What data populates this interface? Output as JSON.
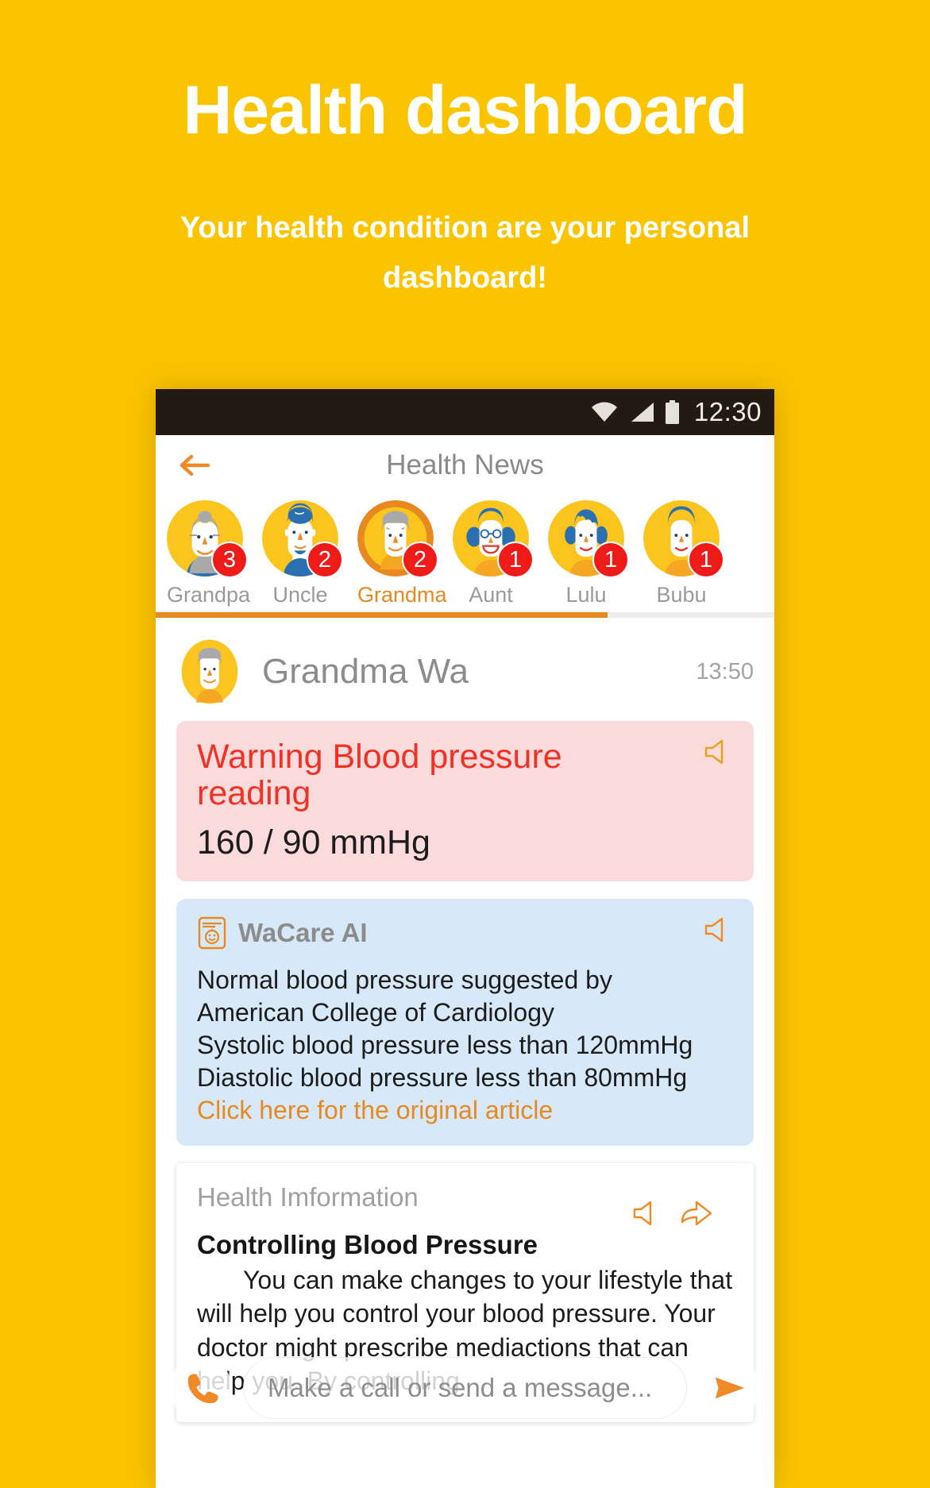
{
  "promo": {
    "title": "Health dashboard",
    "subtitle": "Your health condition are your personal dashboard!"
  },
  "colors": {
    "background": "#FBC400",
    "accent_orange": "#E8891F",
    "warning_red": "#F03226",
    "badge_red": "#EF1B19",
    "warn_card_bg": "#FBDADB",
    "ai_card_bg": "#D7E9F9",
    "statusbar_bg": "#231A14"
  },
  "statusbar": {
    "time": "12:30",
    "icons": [
      "wifi-icon",
      "signal-icon",
      "battery-icon"
    ]
  },
  "appbar": {
    "back_icon": "back-arrow-icon",
    "title": "Health News"
  },
  "tabs": [
    {
      "label": "Grandpa",
      "badge": "3",
      "selected": false,
      "avatar": "grandpa-avatar"
    },
    {
      "label": "Uncle",
      "badge": "2",
      "selected": false,
      "avatar": "uncle-avatar"
    },
    {
      "label": "Grandma",
      "badge": "2",
      "selected": true,
      "avatar": "grandma-avatar"
    },
    {
      "label": "Aunt",
      "badge": "1",
      "selected": false,
      "avatar": "aunt-avatar"
    },
    {
      "label": "Lulu",
      "badge": "1",
      "selected": false,
      "avatar": "lulu-avatar"
    },
    {
      "label": "Bubu",
      "badge": "1",
      "selected": false,
      "avatar": "bubu-avatar"
    }
  ],
  "contact": {
    "name": "Grandma Wa",
    "time": "13:50",
    "avatar": "grandma-avatar"
  },
  "warning_card": {
    "title": "Warning Blood pressure reading",
    "value": "160 / 90 mmHg",
    "speaker_icon": "speaker-icon"
  },
  "ai_card": {
    "app_icon": "wacare-app-icon",
    "name": "WaCare AI",
    "speaker_icon": "speaker-icon",
    "lines": [
      "Normal blood pressure suggested by",
      "American College of Cardiology",
      "Systolic blood pressure less than 120mmHg",
      "Diastolic blood pressure  less than 80mmHg"
    ],
    "link": "Click here for the original article"
  },
  "info_card": {
    "title": "Health Imformation",
    "speaker_icon": "speaker-icon",
    "share_icon": "share-icon",
    "heading": "Controlling Blood Pressure",
    "body": "You can make changes to your lifestyle that will help you control your blood pressure. Your doctor might prescribe mediactions that can help you. By controlling"
  },
  "compose": {
    "call_icon": "phone-icon",
    "placeholder": "Make a call or send a message...",
    "send_icon": "send-icon"
  }
}
